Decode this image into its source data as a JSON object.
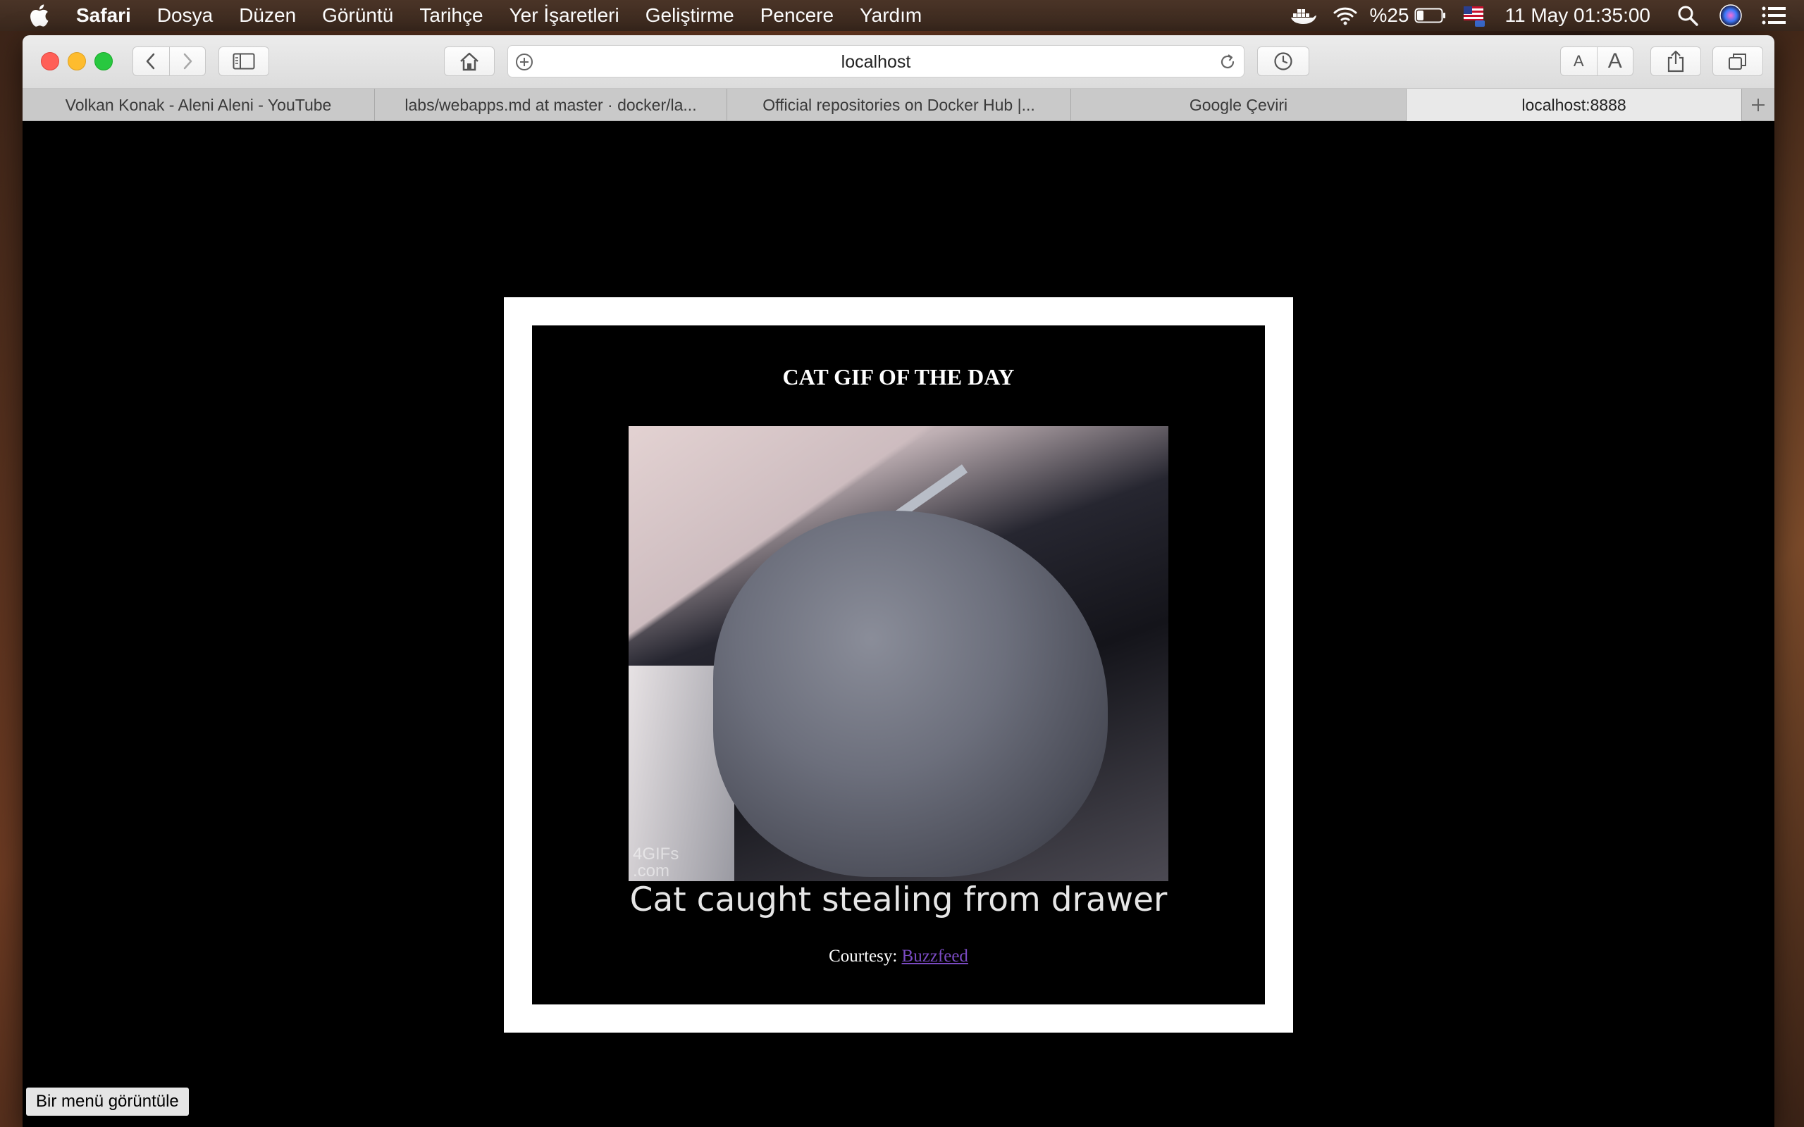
{
  "menubar": {
    "app_name": "Safari",
    "items": [
      "Dosya",
      "Düzen",
      "Görüntü",
      "Tarihçe",
      "Yer İşaretleri",
      "Geliştirme",
      "Pencere",
      "Yardım"
    ],
    "battery": "%25",
    "datetime": "11 May  01:35:00",
    "icons": [
      "apple-icon",
      "docker-icon",
      "wifi-icon",
      "battery-icon",
      "flag-icon",
      "search-icon",
      "siri-icon",
      "notification-list-icon"
    ]
  },
  "toolbar": {
    "address": "localhost",
    "icons": [
      "back-icon",
      "forward-icon",
      "sidebar-icon",
      "home-icon",
      "add-icon",
      "reload-icon",
      "history-icon",
      "share-icon",
      "tabs-icon"
    ],
    "font_small": "A",
    "font_large": "A"
  },
  "tabs": [
    {
      "label": "Volkan Konak - Aleni Aleni - YouTube",
      "active": false
    },
    {
      "label": "labs/webapps.md at master · docker/la...",
      "active": false
    },
    {
      "label": "Official repositories on Docker Hub |...",
      "active": false
    },
    {
      "label": "Google Çeviri",
      "active": false
    },
    {
      "label": "localhost:8888",
      "active": true
    }
  ],
  "page": {
    "title": "CAT GIF OF THE DAY",
    "image_caption": "Cat caught stealing from drawer",
    "watermark_line1": "4GIFs",
    "watermark_line2": ".com",
    "courtesy_label": "Courtesy: ",
    "courtesy_link": "Buzzfeed",
    "link_color": "#7b4bc4"
  },
  "status_bar": {
    "text": "Bir menü görüntüle"
  }
}
